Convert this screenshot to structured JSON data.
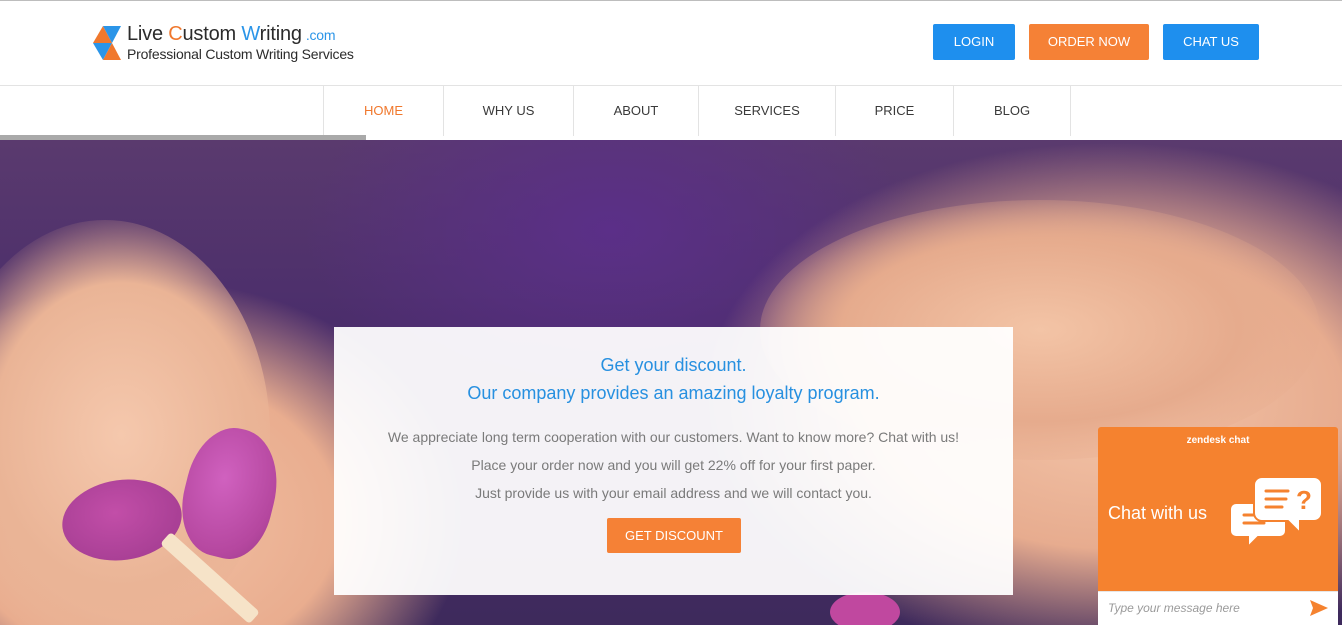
{
  "brand": {
    "title_part1": "Live ",
    "title_c": "C",
    "title_part2": "ustom ",
    "title_w": "W",
    "title_part3": "riting",
    "domain": ".com",
    "tagline": "Professional Custom Writing Services",
    "colors": {
      "orange": "#f0782d",
      "blue": "#2b95e8"
    }
  },
  "header_buttons": {
    "login": "LOGIN",
    "order": "ORDER NOW",
    "chat": "CHAT US"
  },
  "nav": {
    "items": [
      {
        "label": "HOME",
        "active": true
      },
      {
        "label": "WHY US",
        "active": false
      },
      {
        "label": "ABOUT",
        "active": false
      },
      {
        "label": "SERVICES",
        "active": false
      },
      {
        "label": "PRICE",
        "active": false
      },
      {
        "label": "BLOG",
        "active": false
      }
    ]
  },
  "hero": {
    "heading1": "Get your discount.",
    "heading2": "Our company provides an amazing loyalty program.",
    "line1": "We appreciate long term cooperation with our customers. Want to know more? Chat with us!",
    "line2": "Place your order now and you will get 22% off for your first paper.",
    "line3": "Just provide us with your email address and we will contact you.",
    "button": "GET DISCOUNT"
  },
  "chat_widget": {
    "brand": "zendesk chat",
    "title": "Chat with us",
    "input_placeholder": "Type your message here",
    "icon": "chat-bubbles-icon",
    "send_icon": "send-icon",
    "color": "#f5822f"
  }
}
